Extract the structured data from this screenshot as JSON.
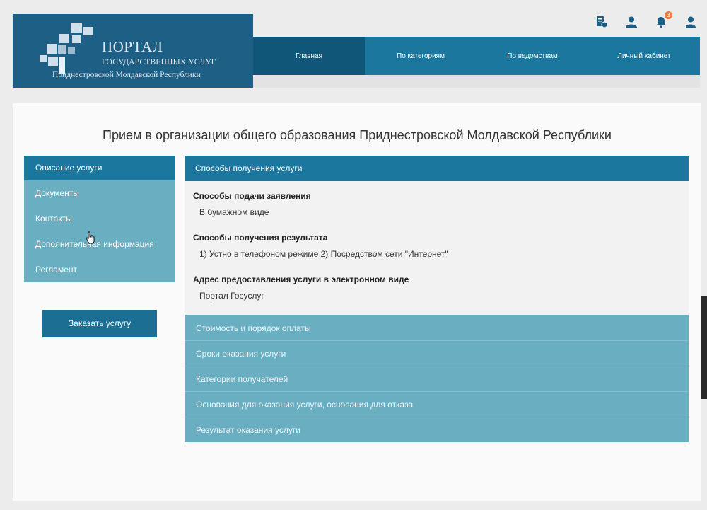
{
  "header": {
    "logo": {
      "line1": "ПОРТАЛ",
      "line2": "ГОСУДАРСТВЕННЫХ УСЛУГ",
      "line3": "Приднестровской Молдавской Республики"
    },
    "nav": [
      {
        "label": "Главная",
        "active": true
      },
      {
        "label": "По категориям",
        "active": false
      },
      {
        "label": "По ведомствам",
        "active": false
      },
      {
        "label": "Личный кабинет",
        "active": false
      }
    ],
    "icons": [
      "document-edit-icon",
      "user-icon",
      "bell-icon",
      "user-icon"
    ],
    "notifications_count": "3"
  },
  "page": {
    "title": "Прием в организации общего образования Приднестровской Молдавской Республики"
  },
  "sidebar": {
    "items": [
      {
        "label": "Описание услуги",
        "active": true
      },
      {
        "label": "Документы"
      },
      {
        "label": "Контакты"
      },
      {
        "label": "Дополнительная информация"
      },
      {
        "label": "Регламент"
      }
    ],
    "order_button": "Заказать услугу"
  },
  "content": {
    "open_section": "Способы получения услуги",
    "fields": [
      {
        "label": "Способы подачи заявления",
        "value": "В бумажном виде"
      },
      {
        "label": "Способы получения результата",
        "value": "1) Устно в телефоном режиме 2) Посредством сети \"Интернет\""
      },
      {
        "label": "Адрес предоставления услуги в электронном виде",
        "value": "Портал Госуслуг"
      }
    ],
    "sections": [
      "Стоимость и порядок оплаты",
      "Сроки оказания услуги",
      "Категории получателей",
      "Основания для оказания услуги, основания для отказа",
      "Результат оказания услуги"
    ]
  },
  "colors": {
    "primary": "#1b779e",
    "header_dark": "#1e5f86",
    "light_teal": "#6aaec2",
    "badge": "#f07a3a"
  }
}
